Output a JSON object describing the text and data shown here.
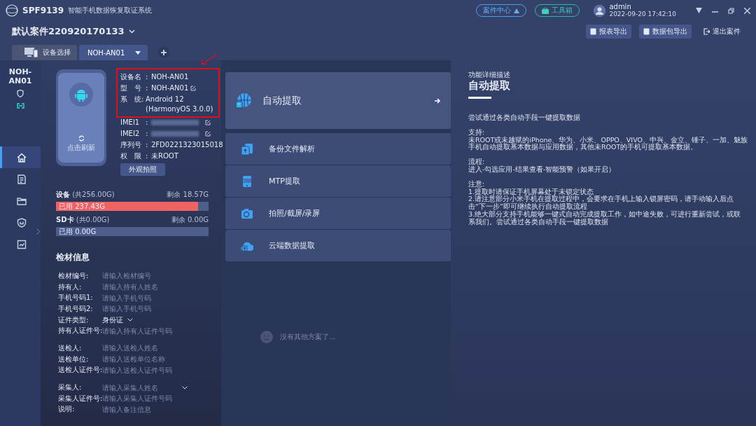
{
  "app": {
    "code": "SPF9139",
    "title": "智能手机数据恢复取证系统"
  },
  "top_buttons": [
    {
      "label": "案件中心",
      "kind": "case"
    },
    {
      "label": "工具箱",
      "kind": "tools"
    }
  ],
  "user": {
    "name": "admin",
    "time": "2022-09-20 17:42:10"
  },
  "case": {
    "title": "默认案件220920170133"
  },
  "case_actions": [
    {
      "label": "报表导出",
      "kind": "filled"
    },
    {
      "label": "数据包导出",
      "kind": "filled"
    },
    {
      "label": "退出案件",
      "kind": "plain"
    }
  ],
  "tabs": [
    {
      "label": "设备选择",
      "kind": "picker",
      "selected": false
    },
    {
      "label": "NOH-AN01",
      "kind": "device",
      "selected": true
    }
  ],
  "sidebar": {
    "device": "NOH-AN01",
    "items": [
      {
        "kind": "home",
        "selected": true
      },
      {
        "kind": "doc",
        "selected": false
      },
      {
        "kind": "folder",
        "selected": false
      },
      {
        "kind": "shield",
        "selected": false
      },
      {
        "kind": "report",
        "selected": false
      }
    ]
  },
  "device": {
    "refresh": "点击刷新",
    "photo_button": "外观拍照",
    "info": [
      {
        "label": "设备名",
        "separator": ":",
        "value": "NOH-AN01",
        "kind": "text",
        "highlighted": true
      },
      {
        "label": "型　号",
        "separator": ":",
        "value": "NOH-AN01",
        "kind": "editable",
        "highlighted": true
      },
      {
        "label": "系　统",
        "separator": ":",
        "value": "Android 12 (HarmonyOS 3.0.0)",
        "kind": "text",
        "highlighted": true
      },
      {
        "label": "IMEI1",
        "separator": ":",
        "kind": "hidden",
        "highlighted": false
      },
      {
        "label": "IMEI2",
        "separator": ":",
        "kind": "hidden",
        "highlighted": false
      },
      {
        "label": "序列号",
        "separator": ":",
        "value": "2FD0221323015018",
        "kind": "text",
        "highlighted": false
      },
      {
        "label": "权　限",
        "separator": ":",
        "value": "未ROOT",
        "kind": "text",
        "highlighted": false
      }
    ]
  },
  "storage": [
    {
      "name": "设备",
      "total": "(共256.00G)",
      "free": "剩余 18.57G",
      "used": "已用 237.43G",
      "level": 0.93
    },
    {
      "name": "SD卡",
      "total": "(共0.00G)",
      "free": "剩余 0.00G",
      "used": "已用 0.00G",
      "level": 0
    }
  ],
  "specimen": {
    "title": "检材信息",
    "groups": [
      [
        {
          "label": "检材编号:",
          "placeholder": "请输入检材编号",
          "kind": "input"
        },
        {
          "label": "持有人:",
          "placeholder": "请输入持有人姓名",
          "kind": "input"
        },
        {
          "label": "手机号码1:",
          "placeholder": "请输入手机号码",
          "kind": "input"
        },
        {
          "label": "手机号码2:",
          "placeholder": "请输入手机号码",
          "kind": "input"
        },
        {
          "label": "证件类型:",
          "value": "身份证",
          "kind": "select"
        },
        {
          "label": "持有人证件号:",
          "placeholder": "请输入持有人证件号码",
          "kind": "input"
        }
      ],
      [
        {
          "label": "送检人:",
          "placeholder": "请输入送检人姓名",
          "kind": "input"
        },
        {
          "label": "送检单位:",
          "placeholder": "请输入送检单位名称",
          "kind": "input"
        },
        {
          "label": "送检人证件号:",
          "placeholder": "请输入送检人证件号码",
          "kind": "input"
        }
      ],
      [
        {
          "label": "采集人:",
          "placeholder": "请输入采集人姓名",
          "kind": "combo"
        },
        {
          "label": "采集人证件号:",
          "placeholder": "请输入采集人证件号码",
          "kind": "input"
        },
        {
          "label": "说明:",
          "placeholder": "请输入备注信息",
          "kind": "input"
        }
      ]
    ]
  },
  "methods": [
    {
      "label": "自动提取",
      "kind": "globe",
      "selected": true
    },
    {
      "label": "备份文件解析",
      "kind": "backup",
      "selected": false
    },
    {
      "label": "MTP提取",
      "kind": "mtp",
      "selected": false
    },
    {
      "label": "拍照/截屏/录屏",
      "kind": "camera",
      "selected": false
    },
    {
      "label": "云端数据提取",
      "kind": "cloud",
      "selected": false
    }
  ],
  "empty_message": "没有其他方案了...",
  "detail": {
    "caption": "功能详细描述",
    "title": "自动提取",
    "paragraphs": [
      [
        "尝试通过各类自动手段一键提取数据"
      ],
      [
        "支持:",
        "未ROOT或未越狱的iPhone、华为、小米、OPPO、VIVO、中兴、金立、锤子、一加、魅族手机自动提取基本数据与应用数据，其他未ROOT的手机可提取基本数据。"
      ],
      [
        "流程:",
        "进入-勾选应用-结果查看-智能预警（如果开启）"
      ],
      [
        "注意:",
        "1.提取时请保证手机屏幕处于未锁定状态",
        "2.请注意部分小米手机在提取过程中，会要求在手机上输入锁屏密码，请手动输入后点击“下一步”即可继续执行自动提取流程",
        "3.绝大部分支持手机能够一键式自动完成提取工作，如中途失败，可进行重新尝试，或联系我们。尝试通过各类自动手段一键提取数据"
      ]
    ]
  }
}
